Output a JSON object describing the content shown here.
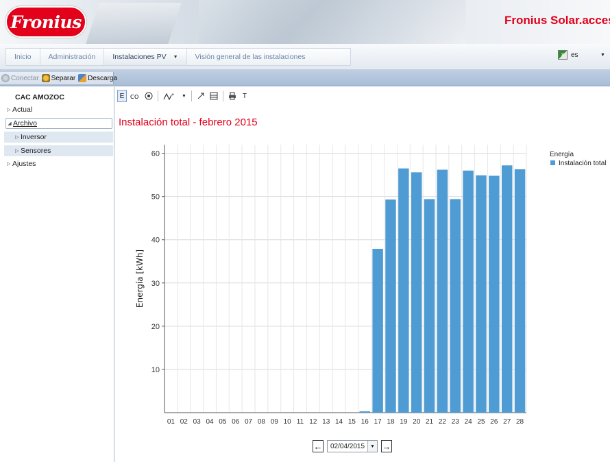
{
  "brand": {
    "logo_text": "Fronius",
    "app_title": "Fronius Solar.access"
  },
  "nav": {
    "tabs": [
      {
        "label": "Inicio"
      },
      {
        "label": "Administración"
      },
      {
        "label": "Instalaciones PV"
      },
      {
        "label": "Visión general de las instalaciones"
      }
    ],
    "language": "es"
  },
  "toolbar": {
    "connect": "Conectar",
    "separate": "Separar",
    "download": "Descarga"
  },
  "sidebar": {
    "title": "CAC AMOZOC",
    "items": [
      {
        "label": "Actual"
      },
      {
        "label": "Archivo"
      },
      {
        "label": "Inversor"
      },
      {
        "label": "Sensores"
      },
      {
        "label": "Ajustes"
      }
    ]
  },
  "chart_tools": [
    "E",
    "T"
  ],
  "colors": {
    "accent": "#e2001a",
    "bar": "#4f9bd4"
  },
  "chart_data": {
    "type": "bar",
    "title": "Instalación total - febrero 2015",
    "ylabel": "Energía [kWh]",
    "xlabel": "",
    "ylim": [
      0,
      62
    ],
    "yticks": [
      10,
      20,
      30,
      40,
      50,
      60
    ],
    "categories": [
      "01",
      "02",
      "03",
      "04",
      "05",
      "06",
      "07",
      "08",
      "09",
      "10",
      "11",
      "12",
      "13",
      "14",
      "15",
      "16",
      "17",
      "18",
      "19",
      "20",
      "21",
      "22",
      "23",
      "24",
      "25",
      "26",
      "27",
      "28"
    ],
    "series": [
      {
        "name": "Instalación total",
        "values": [
          0,
          0,
          0,
          0,
          0,
          0,
          0,
          0,
          0,
          0,
          0,
          0,
          0,
          0,
          0,
          0.3,
          37.9,
          49.3,
          56.5,
          55.6,
          49.4,
          56.2,
          49.4,
          56.0,
          54.9,
          54.8,
          57.2,
          56.3
        ]
      }
    ],
    "legend": {
      "title": "Energía",
      "position": "top-right"
    },
    "grid": true
  },
  "date_nav": {
    "date": "02/04/2015"
  }
}
